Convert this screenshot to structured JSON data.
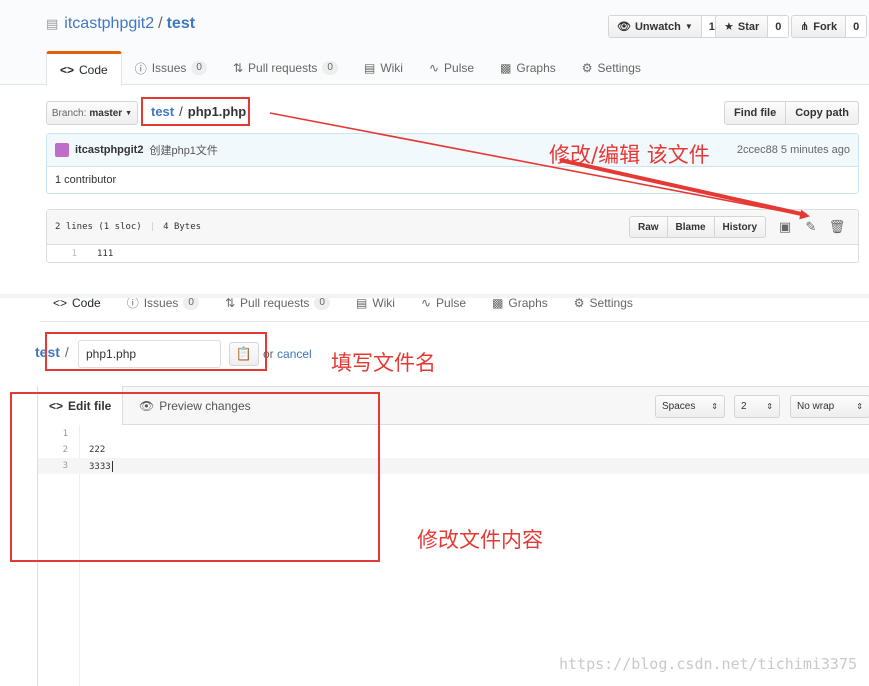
{
  "repo": {
    "owner": "itcastphpgit2",
    "name": "test"
  },
  "actions": {
    "watch_label": "Unwatch",
    "watch_count": "1",
    "star_label": "Star",
    "star_count": "0",
    "fork_label": "Fork",
    "fork_count": "0"
  },
  "tabs": [
    {
      "label": "Code"
    },
    {
      "label": "Issues",
      "count": "0"
    },
    {
      "label": "Pull requests",
      "count": "0"
    },
    {
      "label": "Wiki"
    },
    {
      "label": "Pulse"
    },
    {
      "label": "Graphs"
    },
    {
      "label": "Settings"
    }
  ],
  "file_nav": {
    "branch_prefix": "Branch:",
    "branch": "master",
    "crumb_root": "test",
    "crumb_sep": "/",
    "crumb_file": "php1.php",
    "find_file": "Find file",
    "copy_path": "Copy path"
  },
  "commit": {
    "author": "itcastphpgit2",
    "message": "创建php1文件",
    "sha": "2ccec88",
    "time": "5 minutes ago",
    "contributors": "1 contributor"
  },
  "file": {
    "lines_info": "2 lines (1 sloc)",
    "size": "4 Bytes",
    "raw": "Raw",
    "blame": "Blame",
    "history": "History",
    "code": [
      {
        "n": "1",
        "text": "111"
      }
    ]
  },
  "editor_page": {
    "crumb_root": "test",
    "crumb_sep": "/",
    "filename_value": "php1.php",
    "or_text": "or",
    "cancel": "cancel",
    "tab_edit": "Edit file",
    "tab_preview": "Preview changes",
    "indent_mode": "Spaces",
    "indent_size": "2",
    "wrap_mode": "No wrap",
    "lines": [
      {
        "n": "1",
        "text": ""
      },
      {
        "n": "2",
        "text": "222"
      },
      {
        "n": "3",
        "text": "3333"
      }
    ]
  },
  "annotations": {
    "edit_file": "修改/编辑  该文件",
    "fill_name": "填写文件名",
    "edit_content": "修改文件内容"
  },
  "watermark": "https://blog.csdn.net/tichimi3375",
  "colors": {
    "accent_tab": "#e36209",
    "link": "#4078c0",
    "annotation_red": "#e53935"
  }
}
